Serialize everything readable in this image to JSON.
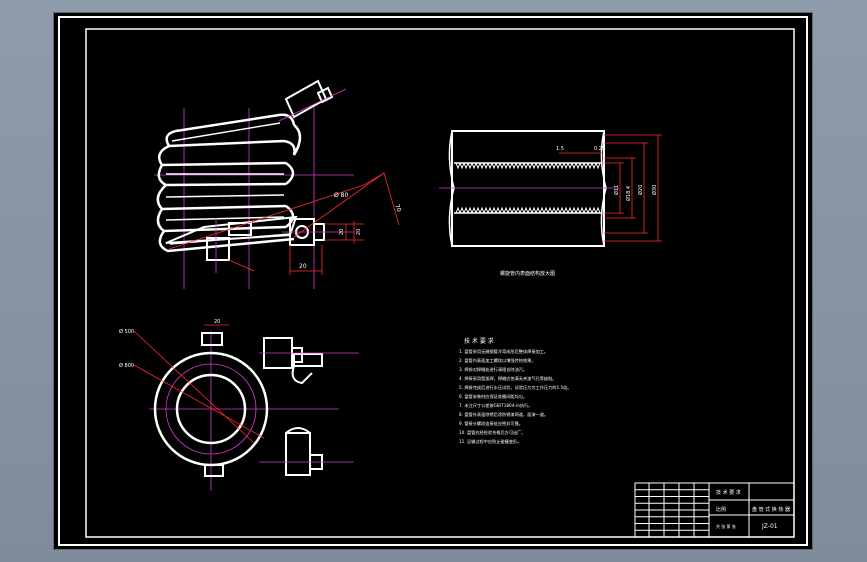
{
  "drawing": {
    "colors": {
      "background": "#000000",
      "outline": "#ffffff",
      "centerline": "#d23bd2",
      "dimension": "#ff2a2a",
      "table_line": "#ffffff"
    },
    "front_view": {
      "dimensions": [
        "Ø 80",
        "70",
        "20"
      ],
      "bolt_dims": [
        "20",
        "20"
      ]
    },
    "section_view": {
      "dimensions": [
        "1.5",
        "0.25",
        "Ø11",
        "Ø18.4",
        "Ø20",
        "Ø30"
      ],
      "caption": "螺旋管内表面结构放大图"
    },
    "top_view": {
      "dimensions": [
        "20",
        "Ø 500",
        "Ø 800"
      ]
    },
    "tech_requirements": {
      "title": "技 术 要 求",
      "items": [
        "1. 盘管采用无缝钢管冷弯成形后整体焊接加工。",
        "2. 盘管内表面加工螺纹以增强传热效果。",
        "3. 焊前对焊缝处进行清理去除油污。",
        "4. 焊接采用氩弧焊，焊缝应饱满无夹渣气孔等缺陷。",
        "5. 焊接完成后进行水压试验，试验压力为工作压力的1.5倍。",
        "6. 盘管安装时应保证各圈间距均匀。",
        "7. 未注尺寸公差按GB/T1804-m执行。",
        "8. 盘管外表面除锈后涂防锈漆两道，面漆一道。",
        "9. 管接头螺纹连接处应密封可靠。",
        "10. 盘管应经检验合格后方可出厂。",
        "11. 运输过程中应防止碰撞变形。"
      ]
    },
    "title_block": {
      "part_name": "盘 管 式 换 热 器",
      "title_cell": "技 术 要 求",
      "drawing_no": "JZ-01",
      "scale_label": "比例",
      "sheet_label": "共 张 第 张"
    }
  }
}
